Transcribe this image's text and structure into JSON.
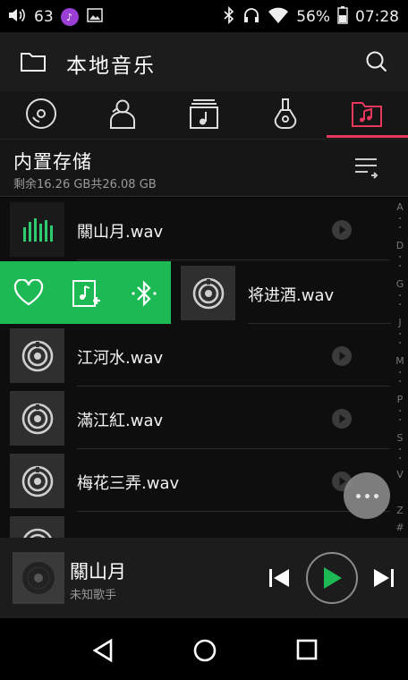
{
  "status_bar": {
    "notification_count": "63",
    "battery": "56%",
    "time": "07:28",
    "icons": [
      "volume-icon",
      "music-app-icon",
      "image-icon",
      "bluetooth-icon",
      "headphones-icon",
      "wifi-icon",
      "battery-icon"
    ]
  },
  "app_bar": {
    "title": "本地音乐"
  },
  "tabs": {
    "items": [
      {
        "icon": "disc-icon"
      },
      {
        "icon": "artist-icon"
      },
      {
        "icon": "album-icon"
      },
      {
        "icon": "guitar-icon"
      },
      {
        "icon": "folder-music-icon",
        "active": true
      }
    ],
    "accent": "#e8365d"
  },
  "storage": {
    "name": "内置存储",
    "size": "剩余16.26 GB共26.08 GB"
  },
  "songs": [
    {
      "title": "關山月.wav",
      "playing": true
    },
    {
      "title": "将进酒.wav",
      "swiped": true
    },
    {
      "title": "江河水.wav"
    },
    {
      "title": "滿江紅.wav"
    },
    {
      "title": "梅花三弄.wav"
    }
  ],
  "swipe_actions": {
    "color": "#1db954",
    "icons": [
      "heart-icon",
      "add-to-playlist-icon",
      "bluetooth-icon"
    ]
  },
  "index_letters": [
    "A",
    "D",
    "G",
    "J",
    "M",
    "P",
    "S",
    "V",
    "Z",
    "#"
  ],
  "player": {
    "title": "關山月",
    "artist": "未知歌手",
    "play_color": "#1db954"
  }
}
